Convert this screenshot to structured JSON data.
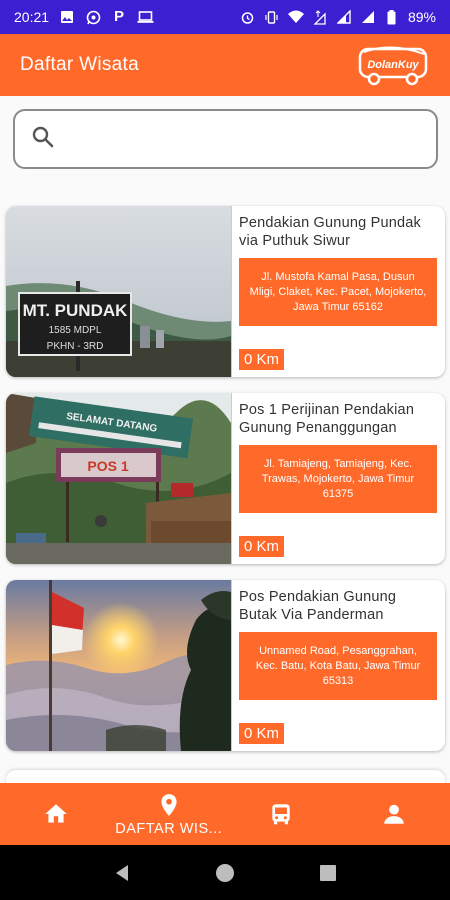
{
  "status_bar": {
    "time": "20:21",
    "battery": "89%",
    "left_icons": [
      "image-icon",
      "whatsapp-icon",
      "p-icon",
      "laptop-icon"
    ],
    "right_icons": [
      "alarm-icon",
      "vibrate-icon",
      "wifi-icon",
      "data-icon",
      "signal-icon",
      "signal-icon",
      "battery-icon"
    ]
  },
  "app_bar": {
    "title": "Daftar Wisata",
    "logo_text": "DolanKuy"
  },
  "search": {
    "placeholder": "",
    "value": ""
  },
  "places": [
    {
      "title": "Pendakian Gunung Pundak via Puthuk Siwur",
      "address": "Jl. Mustofa Kamal Pasa, Dusun Mligi, Claket, Kec. Pacet, Mojokerto, Jawa Timur 65162",
      "distance": "0 Km",
      "image": "mountain-sign-photo",
      "sign_line1": "MT. PUNDAK",
      "sign_line2": "1585 MDPL",
      "sign_line3": "PKHN - 3RD"
    },
    {
      "title": "Pos 1 Perijinan Pendakian Gunung Penanggungan",
      "address": "Jl. Tamiajeng, Tamiajeng, Kec. Trawas, Mojokerto, Jawa Timur 61375",
      "distance": "0 Km",
      "image": "hiking-post-photo",
      "banner_text": "SELAMAT DATANG",
      "pos_text": "POS 1"
    },
    {
      "title": "Pos Pendakian Gunung Butak Via Panderman",
      "address": "Unnamed Road, Pesanggrahan, Kec. Batu, Kota Batu, Jawa Timur 65313",
      "distance": "0 Km",
      "image": "sunrise-clouds-photo"
    }
  ],
  "bottom_nav": [
    {
      "icon": "home-icon",
      "label": ""
    },
    {
      "icon": "location-pin-icon",
      "label": "DAFTAR WIS..."
    },
    {
      "icon": "bus-icon",
      "label": ""
    },
    {
      "icon": "person-icon",
      "label": ""
    }
  ],
  "colors": {
    "accent": "#ff6a2b",
    "status_bar": "#3b1fd1"
  }
}
